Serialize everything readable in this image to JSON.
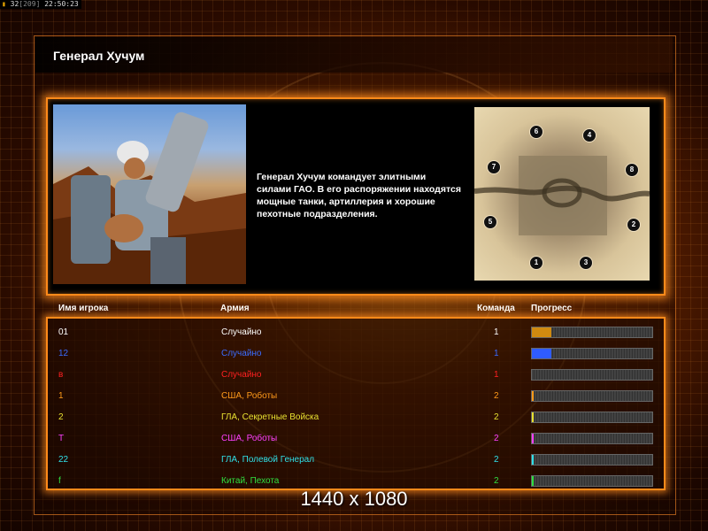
{
  "debug": {
    "fps": "32",
    "bracket": "[209]",
    "time": "22:50:23"
  },
  "title": "Генерал Хучум",
  "description": "Генерал Хучум командует элитными силами ГАО. В его распоряжении находятся мощные танки, артиллерия и хорошие пехотные подразделения.",
  "minimap": {
    "spawns": [
      "6",
      "4",
      "7",
      "8",
      "5",
      "2",
      "1",
      "3"
    ]
  },
  "table": {
    "headers": {
      "player": "Имя игрока",
      "army": "Армия",
      "team": "Команда",
      "progress": "Прогресс"
    },
    "rows": [
      {
        "name": "01",
        "army": "Случайно",
        "team": "1",
        "color": "#ffffff",
        "progress": 0.16,
        "fill": "#d08a10"
      },
      {
        "name": "12",
        "army": "Случайно",
        "team": "1",
        "color": "#3a6cff",
        "progress": 0.16,
        "fill": "#2f5cff"
      },
      {
        "name": "в",
        "army": "Случайно",
        "team": "1",
        "color": "#ff2020",
        "progress": 0.0,
        "fill": "#ff2020"
      },
      {
        "name": "1",
        "army": "США, Роботы",
        "team": "2",
        "color": "#ff9a1a",
        "progress": 0.01,
        "fill": "#ff9a1a"
      },
      {
        "name": "2",
        "army": "ГЛА, Секретные Войска",
        "team": "2",
        "color": "#e8e030",
        "progress": 0.01,
        "fill": "#e8e030"
      },
      {
        "name": "Т",
        "army": "США, Роботы",
        "team": "2",
        "color": "#ff40ff",
        "progress": 0.01,
        "fill": "#ff40ff"
      },
      {
        "name": "22",
        "army": "ГЛА, Полевой Генерал",
        "team": "2",
        "color": "#30e0e8",
        "progress": 0.01,
        "fill": "#30e0e8"
      },
      {
        "name": "f",
        "army": "Китай, Пехота",
        "team": "2",
        "color": "#30e040",
        "progress": 0.01,
        "fill": "#30e040"
      }
    ]
  },
  "resolution": "1440 x 1080"
}
